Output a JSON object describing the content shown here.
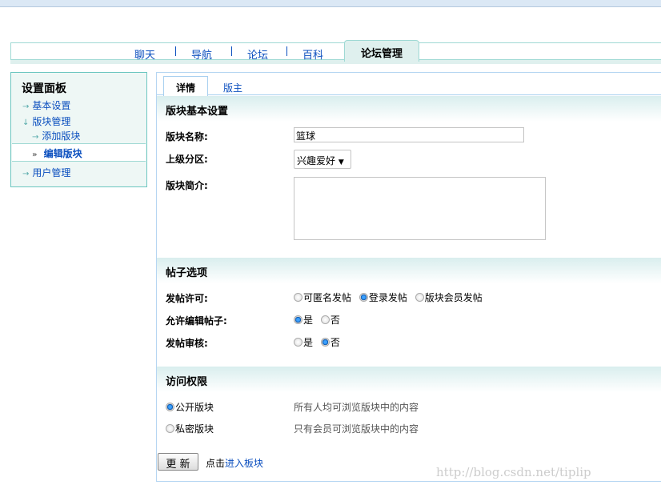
{
  "nav": {
    "items": [
      "聊天",
      "导航",
      "论坛",
      "百科"
    ],
    "active": "论坛管理"
  },
  "sidebar": {
    "title": "设置面板",
    "items": [
      "基本设置",
      "版块管理",
      "添加版块",
      "编辑版块",
      "用户管理"
    ]
  },
  "tabs": [
    "详情",
    "版主"
  ],
  "basic": {
    "title": "版块基本设置",
    "name_label": "版块名称:",
    "name_value": "篮球",
    "parent_label": "上级分区:",
    "parent_value": "兴趣爱好",
    "desc_label": "版块简介:"
  },
  "posts": {
    "title": "帖子选项",
    "perm_label": "发帖许可:",
    "perm_opts": [
      "可匿名发帖",
      "登录发帖",
      "版块会员发帖"
    ],
    "edit_label": "允许编辑帖子:",
    "audit_label": "发帖审核:",
    "yes": "是",
    "no": "否"
  },
  "access": {
    "title": "访问权限",
    "public": "公开版块",
    "public_desc": "所有人均可浏览版块中的内容",
    "private": "私密版块",
    "private_desc": "只有会员可浏览版块中的内容"
  },
  "footer": {
    "button": "更 新",
    "hint": "点击",
    "link": "进入板块"
  },
  "watermark": "http://blog.csdn.net/tiplip"
}
